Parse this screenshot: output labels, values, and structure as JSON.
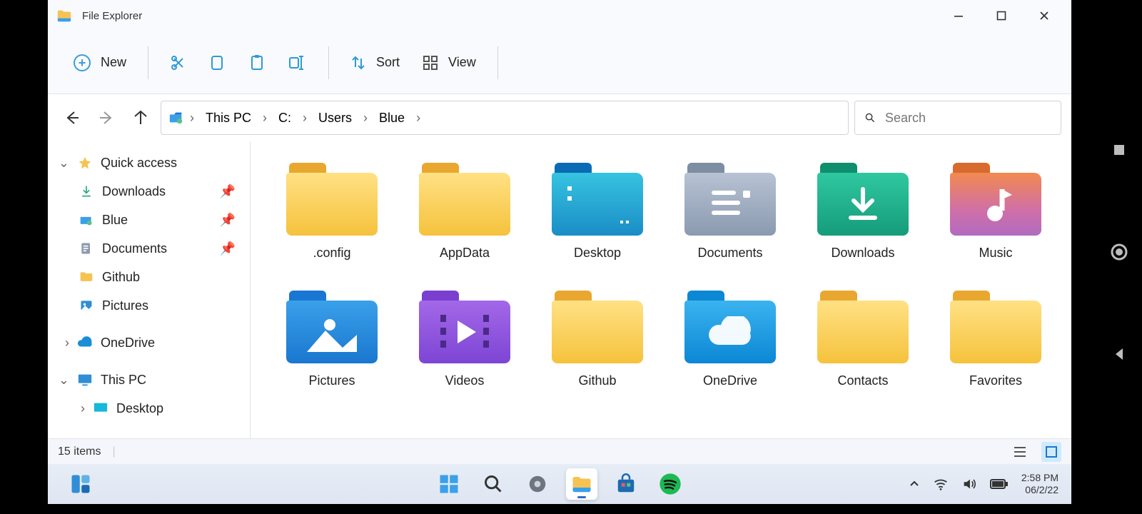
{
  "window": {
    "title": "File Explorer"
  },
  "toolbar": {
    "new": "New",
    "sort": "Sort",
    "view": "View"
  },
  "breadcrumbs": [
    "This PC",
    "C:",
    "Users",
    "Blue"
  ],
  "search": {
    "placeholder": "Search"
  },
  "sidebar": {
    "quick_access": "Quick access",
    "items": [
      {
        "label": "Downloads",
        "pinned": true
      },
      {
        "label": "Blue",
        "pinned": true
      },
      {
        "label": "Documents",
        "pinned": true
      },
      {
        "label": "Github",
        "pinned": false
      },
      {
        "label": "Pictures",
        "pinned": false
      }
    ],
    "onedrive": "OneDrive",
    "this_pc": "This PC",
    "desktop": "Desktop"
  },
  "folders": [
    {
      "name": ".config",
      "style": "yellow",
      "icon": "none"
    },
    {
      "name": "AppData",
      "style": "yellow",
      "icon": "none"
    },
    {
      "name": "Desktop",
      "style": "teal",
      "icon": "desktop"
    },
    {
      "name": "Documents",
      "style": "gray",
      "icon": "doc"
    },
    {
      "name": "Downloads",
      "style": "green",
      "icon": "download"
    },
    {
      "name": "Music",
      "style": "orange",
      "icon": "music"
    },
    {
      "name": "Pictures",
      "style": "blue",
      "icon": "picture"
    },
    {
      "name": "Videos",
      "style": "purple",
      "icon": "video"
    },
    {
      "name": "Github",
      "style": "yellow",
      "icon": "none"
    },
    {
      "name": "OneDrive",
      "style": "sky",
      "icon": "cloud"
    },
    {
      "name": "Contacts",
      "style": "yellow",
      "icon": "none"
    },
    {
      "name": "Favorites",
      "style": "yellow",
      "icon": "none"
    }
  ],
  "status": {
    "count": "15 items"
  },
  "system": {
    "time": "2:58 PM",
    "date": "06/2/22"
  }
}
